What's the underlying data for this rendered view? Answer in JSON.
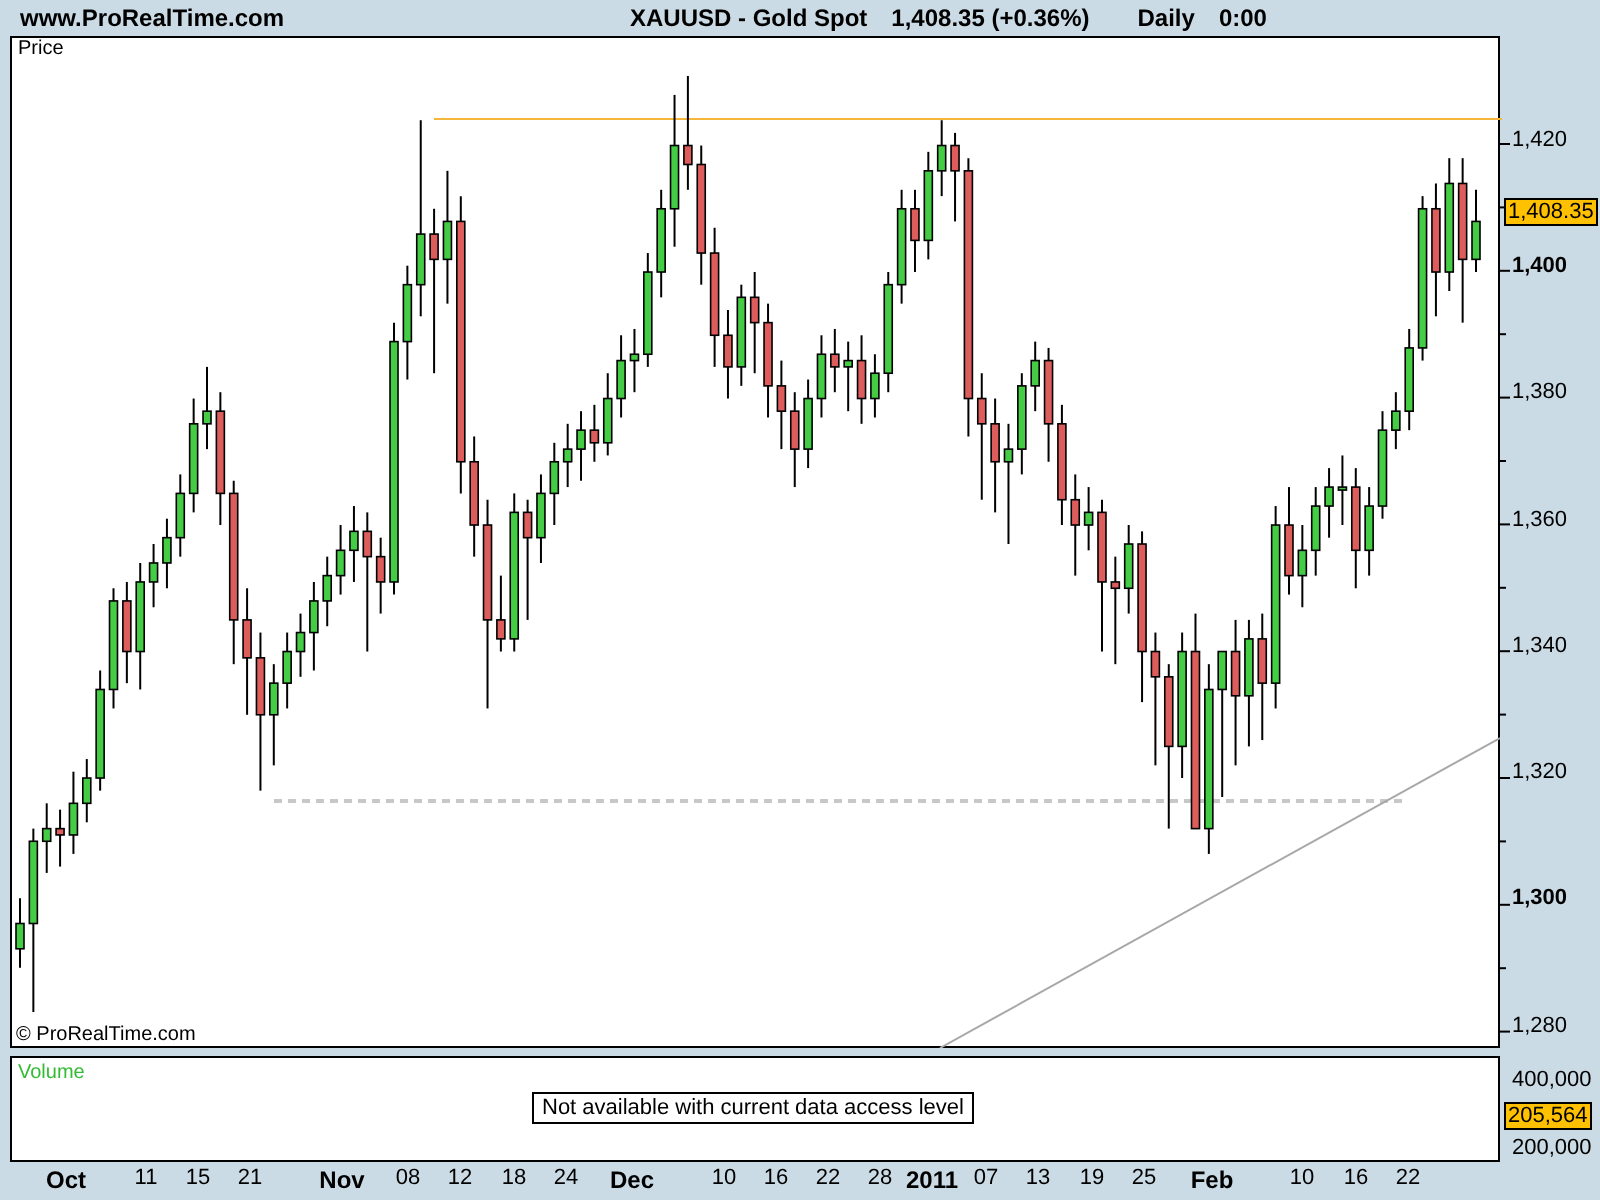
{
  "header": {
    "site": "www.ProRealTime.com",
    "symbol": "XAUUSD - Gold Spot",
    "quote": "1,408.35 (+0.36%)",
    "period": "Daily",
    "time": "0:00"
  },
  "price_panel": {
    "title": "Price",
    "copyright": "© ProRealTime.com",
    "last_price": "1,408.35",
    "chart_data": {
      "type": "candlestick",
      "ylim": [
        1277,
        1437
      ],
      "yticks": [
        {
          "value": 1420,
          "label": "1,420"
        },
        {
          "value": 1400,
          "label": "1,400"
        },
        {
          "value": 1380,
          "label": "1,380"
        },
        {
          "value": 1360,
          "label": "1,360"
        },
        {
          "value": 1340,
          "label": "1,340"
        },
        {
          "value": 1320,
          "label": "1,320"
        },
        {
          "value": 1300,
          "label": "1,300"
        },
        {
          "value": 1280,
          "label": "1,280"
        }
      ],
      "ref_lines": [
        {
          "axis": "y",
          "value": 1424.4,
          "color": "#f5b73a"
        },
        {
          "axis": "y",
          "value": 1316.5,
          "color": "#c8c8c8"
        }
      ],
      "categories": [
        null,
        null,
        null,
        null,
        null,
        null,
        null,
        null,
        null,
        null,
        null,
        null,
        null,
        null,
        null,
        null,
        null,
        null,
        null,
        null,
        null,
        null,
        null,
        null,
        null,
        null,
        null,
        null,
        null,
        null,
        null,
        null,
        null,
        null,
        null,
        null,
        null,
        null,
        null,
        null,
        null,
        null,
        null,
        null,
        null,
        null,
        null,
        null,
        null,
        null,
        null,
        null,
        null,
        null,
        null,
        null,
        null,
        null,
        null,
        null,
        null,
        null,
        null,
        null,
        null,
        null,
        null,
        null,
        null,
        null,
        null,
        null,
        null,
        null,
        null,
        null,
        null,
        null,
        null,
        null,
        null,
        null,
        null,
        null,
        null,
        null,
        null,
        null,
        null,
        null,
        null,
        null,
        null,
        null,
        null,
        null,
        null,
        null,
        null,
        null,
        null,
        null,
        null,
        null,
        null,
        null,
        null,
        null,
        null,
        null
      ],
      "ohlc": [
        [
          1293,
          1301,
          1290,
          1297
        ],
        [
          1297,
          1312,
          1283,
          1310
        ],
        [
          1310,
          1316,
          1305,
          1312
        ],
        [
          1312,
          1315,
          1306,
          1311
        ],
        [
          1311,
          1321,
          1308,
          1316
        ],
        [
          1316,
          1323,
          1313,
          1320
        ],
        [
          1320,
          1337,
          1318,
          1334
        ],
        [
          1334,
          1350,
          1331,
          1348
        ],
        [
          1348,
          1351,
          1335,
          1340
        ],
        [
          1340,
          1354,
          1334,
          1351
        ],
        [
          1351,
          1357,
          1347,
          1354
        ],
        [
          1354,
          1361,
          1350,
          1358
        ],
        [
          1358,
          1368,
          1355,
          1365
        ],
        [
          1365,
          1380,
          1362,
          1376
        ],
        [
          1376,
          1385,
          1372,
          1378
        ],
        [
          1378,
          1381,
          1360,
          1365
        ],
        [
          1365,
          1367,
          1338,
          1345
        ],
        [
          1345,
          1350,
          1330,
          1339
        ],
        [
          1339,
          1343,
          1318,
          1330
        ],
        [
          1330,
          1338,
          1322,
          1335
        ],
        [
          1335,
          1343,
          1331,
          1340
        ],
        [
          1340,
          1346,
          1336,
          1343
        ],
        [
          1343,
          1351,
          1337,
          1348
        ],
        [
          1348,
          1355,
          1344,
          1352
        ],
        [
          1352,
          1360,
          1349,
          1356
        ],
        [
          1356,
          1363,
          1351,
          1359
        ],
        [
          1359,
          1362,
          1340,
          1355
        ],
        [
          1355,
          1358,
          1346,
          1351
        ],
        [
          1351,
          1392,
          1349,
          1389
        ],
        [
          1389,
          1401,
          1383,
          1398
        ],
        [
          1398,
          1424,
          1393,
          1406
        ],
        [
          1406,
          1410,
          1384,
          1402
        ],
        [
          1402,
          1416,
          1395,
          1408
        ],
        [
          1408,
          1412,
          1365,
          1370
        ],
        [
          1370,
          1374,
          1355,
          1360
        ],
        [
          1360,
          1364,
          1331,
          1345
        ],
        [
          1345,
          1352,
          1340,
          1342
        ],
        [
          1342,
          1365,
          1340,
          1362
        ],
        [
          1362,
          1364,
          1345,
          1358
        ],
        [
          1358,
          1368,
          1354,
          1365
        ],
        [
          1365,
          1373,
          1360,
          1370
        ],
        [
          1370,
          1376,
          1366,
          1372
        ],
        [
          1372,
          1378,
          1367,
          1375
        ],
        [
          1375,
          1379,
          1370,
          1373
        ],
        [
          1373,
          1384,
          1371,
          1380
        ],
        [
          1380,
          1390,
          1377,
          1386
        ],
        [
          1386,
          1391,
          1381,
          1387
        ],
        [
          1387,
          1403,
          1385,
          1400
        ],
        [
          1400,
          1413,
          1396,
          1410
        ],
        [
          1410,
          1428,
          1404,
          1420
        ],
        [
          1420,
          1431,
          1413,
          1417
        ],
        [
          1417,
          1420,
          1398,
          1403
        ],
        [
          1403,
          1407,
          1385,
          1390
        ],
        [
          1390,
          1394,
          1380,
          1385
        ],
        [
          1385,
          1398,
          1382,
          1396
        ],
        [
          1396,
          1400,
          1384,
          1392
        ],
        [
          1392,
          1395,
          1377,
          1382
        ],
        [
          1382,
          1386,
          1372,
          1378
        ],
        [
          1378,
          1381,
          1366,
          1372
        ],
        [
          1372,
          1383,
          1369,
          1380
        ],
        [
          1380,
          1390,
          1377,
          1387
        ],
        [
          1387,
          1391,
          1381,
          1385
        ],
        [
          1385,
          1389,
          1378,
          1386
        ],
        [
          1386,
          1390,
          1376,
          1380
        ],
        [
          1380,
          1387,
          1377,
          1384
        ],
        [
          1384,
          1400,
          1381,
          1398
        ],
        [
          1398,
          1413,
          1395,
          1410
        ],
        [
          1410,
          1413,
          1400,
          1405
        ],
        [
          1405,
          1419,
          1402,
          1416
        ],
        [
          1416,
          1424,
          1412,
          1420
        ],
        [
          1420,
          1422,
          1408,
          1416
        ],
        [
          1416,
          1418,
          1374,
          1380
        ],
        [
          1380,
          1384,
          1364,
          1376
        ],
        [
          1376,
          1380,
          1362,
          1370
        ],
        [
          1370,
          1376,
          1357,
          1372
        ],
        [
          1372,
          1384,
          1368,
          1382
        ],
        [
          1382,
          1389,
          1378,
          1386
        ],
        [
          1386,
          1388,
          1370,
          1376
        ],
        [
          1376,
          1379,
          1360,
          1364
        ],
        [
          1364,
          1368,
          1352,
          1360
        ],
        [
          1360,
          1366,
          1356,
          1362
        ],
        [
          1362,
          1364,
          1340,
          1351
        ],
        [
          1351,
          1355,
          1338,
          1350
        ],
        [
          1350,
          1360,
          1346,
          1357
        ],
        [
          1357,
          1359,
          1332,
          1340
        ],
        [
          1340,
          1343,
          1322,
          1336
        ],
        [
          1336,
          1338,
          1312,
          1325
        ],
        [
          1325,
          1343,
          1320,
          1340
        ],
        [
          1340,
          1346,
          1312,
          1312
        ],
        [
          1312,
          1338,
          1308,
          1334
        ],
        [
          1334,
          1340,
          1317,
          1340
        ],
        [
          1340,
          1345,
          1322,
          1333
        ],
        [
          1333,
          1345,
          1325,
          1342
        ],
        [
          1342,
          1346,
          1326,
          1335
        ],
        [
          1335,
          1363,
          1331,
          1360
        ],
        [
          1360,
          1366,
          1349,
          1352
        ],
        [
          1352,
          1360,
          1347,
          1356
        ],
        [
          1356,
          1366,
          1352,
          1363
        ],
        [
          1363,
          1369,
          1358,
          1366
        ],
        [
          1366,
          1371,
          1360,
          1366
        ],
        [
          1366,
          1369,
          1350,
          1356
        ],
        [
          1356,
          1366,
          1352,
          1363
        ],
        [
          1363,
          1378,
          1361,
          1375
        ],
        [
          1375,
          1381,
          1372,
          1378
        ],
        [
          1378,
          1391,
          1375,
          1388
        ],
        [
          1388,
          1412,
          1386,
          1410
        ],
        [
          1410,
          1414,
          1393,
          1400
        ],
        [
          1400,
          1418,
          1397,
          1414
        ],
        [
          1414,
          1418,
          1392,
          1402
        ],
        [
          1402,
          1413,
          1400,
          1408
        ]
      ]
    }
  },
  "volume_panel": {
    "title": "Volume",
    "notice": "Not available with current data access level",
    "axis_labels": [
      "400,000",
      "200,000"
    ],
    "last_value": "205,564"
  },
  "time_axis": [
    {
      "label": "Oct",
      "major": true
    },
    {
      "label": "11",
      "major": false
    },
    {
      "label": "15",
      "major": false
    },
    {
      "label": "21",
      "major": false
    },
    {
      "label": "Nov",
      "major": true
    },
    {
      "label": "08",
      "major": false
    },
    {
      "label": "12",
      "major": false
    },
    {
      "label": "18",
      "major": false
    },
    {
      "label": "24",
      "major": false
    },
    {
      "label": "Dec",
      "major": true
    },
    {
      "label": "10",
      "major": false
    },
    {
      "label": "16",
      "major": false
    },
    {
      "label": "22",
      "major": false
    },
    {
      "label": "28",
      "major": false
    },
    {
      "label": "2011",
      "major": true
    },
    {
      "label": "07",
      "major": false
    },
    {
      "label": "13",
      "major": false
    },
    {
      "label": "19",
      "major": false
    },
    {
      "label": "25",
      "major": false
    },
    {
      "label": "Feb",
      "major": true
    },
    {
      "label": "10",
      "major": false
    },
    {
      "label": "16",
      "major": false
    },
    {
      "label": "22",
      "major": false
    }
  ]
}
